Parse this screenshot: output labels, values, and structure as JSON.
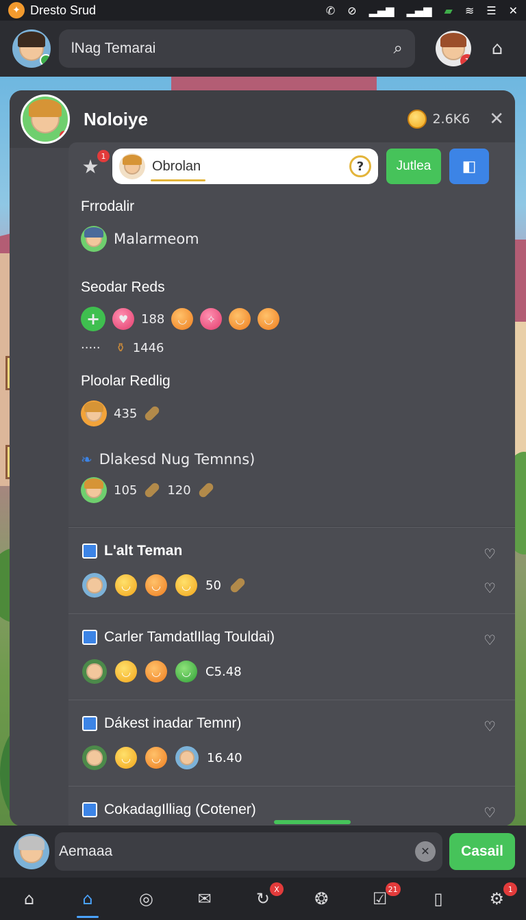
{
  "statusbar": {
    "app_title": "Dresto Srud",
    "icons": [
      "phone-icon",
      "no-signal-icon",
      "signal-icon",
      "signal-icon",
      "battery-icon",
      "wifi-icon",
      "menu-icon",
      "close-icon"
    ]
  },
  "topbar": {
    "search_value": "lNag Temarai",
    "profile_badge": "1"
  },
  "panel": {
    "name": "Noloiye",
    "coins": "2.6K6",
    "chip_label": "Obrolan",
    "star_badge": "1",
    "green_button": "Jutlea",
    "sections": {
      "friends_title": "Frrodalir",
      "friend_name": "Malarmeom",
      "reds_title": "Seodar Reds",
      "reds_count": "188",
      "dots": "·····",
      "bag_count": "1446",
      "popular_title": "Ploolar Redlig",
      "popular_count": "435",
      "blaked_title": "Dlakesd Nug Temnns)",
      "blaked_count_a": "105",
      "blaked_count_b": "120"
    }
  },
  "list": [
    {
      "title": "L'alt Teman",
      "value": "50"
    },
    {
      "title": "Carler TamdatlIlag Touldai)",
      "value": "C5.48"
    },
    {
      "title": "Dákest inadar Temnr)",
      "value": "16.40"
    },
    {
      "title": "CokadagIlliag (Cotener)",
      "value": ""
    }
  ],
  "chatbar": {
    "input_value": "Aemaaa",
    "send_label": "Casail"
  },
  "navbar": {
    "items": [
      {
        "icon": "home-icon",
        "badge": ""
      },
      {
        "icon": "house-active-icon",
        "badge": ""
      },
      {
        "icon": "compass-icon",
        "badge": ""
      },
      {
        "icon": "mail-icon",
        "badge": ""
      },
      {
        "icon": "refresh-icon",
        "badge": "X"
      },
      {
        "icon": "globe-icon",
        "badge": ""
      },
      {
        "icon": "check-box-icon",
        "badge": "21"
      },
      {
        "icon": "phone-icon",
        "badge": ""
      },
      {
        "icon": "settings-icon",
        "badge": "1"
      }
    ]
  },
  "colors": {
    "accent_green": "#46c35a",
    "accent_blue": "#3c84e6",
    "badge_red": "#e23b3b",
    "panel": "#46474d"
  }
}
